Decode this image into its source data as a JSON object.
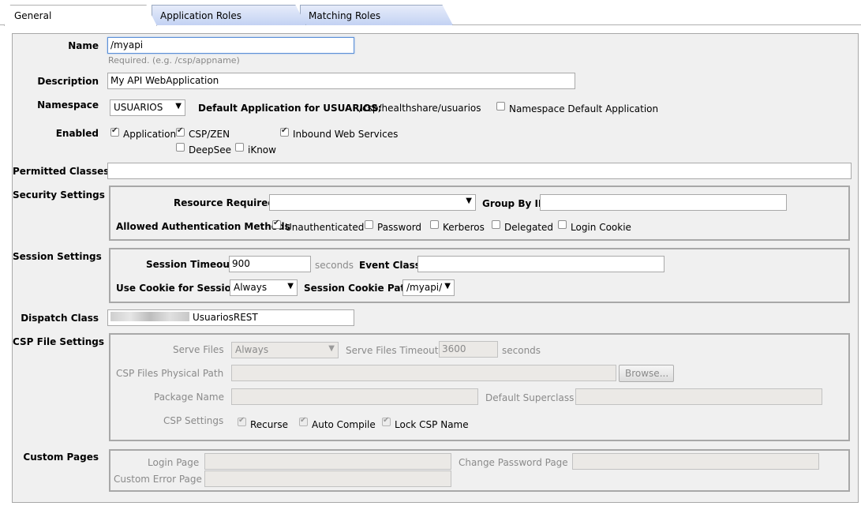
{
  "tabs": [
    {
      "label": "General",
      "active": true
    },
    {
      "label": "Application Roles",
      "active": false
    },
    {
      "label": "Matching Roles",
      "active": false
    }
  ],
  "name": {
    "label": "Name",
    "value": "/myapi",
    "hint": "Required. (e.g. /csp/appname)"
  },
  "description": {
    "label": "Description",
    "value": "My API WebApplication"
  },
  "namespace": {
    "label": "Namespace",
    "value": "USUARIOS",
    "default_app_label": "Default Application for USUARIOS:",
    "default_app_value": "/csp/healthshare/usuarios",
    "ns_default_label": "Namespace Default Application"
  },
  "enabled": {
    "label": "Enabled",
    "application": "Application",
    "csp_zen": "CSP/ZEN",
    "inbound": "Inbound Web Services",
    "deepsee": "DeepSee",
    "iknow": "iKnow"
  },
  "permitted_classes": {
    "label": "Permitted Classes",
    "value": ""
  },
  "security": {
    "label": "Security Settings",
    "resource_label": "Resource Required",
    "resource_value": "",
    "group_label": "Group By ID",
    "group_value": "",
    "auth_label": "Allowed Authentication Methods",
    "unauthenticated": "Unauthenticated",
    "password": "Password",
    "kerberos": "Kerberos",
    "delegated": "Delegated",
    "login_cookie": "Login Cookie"
  },
  "session": {
    "label": "Session Settings",
    "timeout_label": "Session Timeout",
    "timeout_value": "900",
    "seconds": "seconds",
    "event_label": "Event Class",
    "event_value": "",
    "cookie_label": "Use Cookie for Session",
    "cookie_value": "Always",
    "cookie_path_label": "Session Cookie Path",
    "cookie_path_value": "/myapi/"
  },
  "dispatch": {
    "label": "Dispatch Class",
    "value": "UsuariosREST"
  },
  "csp_files": {
    "label": "CSP File Settings",
    "serve_label": "Serve Files",
    "serve_value": "Always",
    "timeout_label": "Serve Files Timeout",
    "timeout_value": "3600",
    "seconds": "seconds",
    "path_label": "CSP Files Physical Path",
    "path_value": "",
    "browse": "Browse...",
    "package_label": "Package Name",
    "package_value": "",
    "superclass_label": "Default Superclass",
    "superclass_value": "",
    "csp_settings_label": "CSP Settings",
    "recurse": "Recurse",
    "auto_compile": "Auto Compile",
    "lock_name": "Lock CSP Name"
  },
  "custom_pages": {
    "label": "Custom Pages",
    "login_label": "Login Page",
    "login_value": "",
    "change_pw_label": "Change Password Page",
    "change_pw_value": "",
    "error_label": "Custom Error Page",
    "error_value": ""
  }
}
